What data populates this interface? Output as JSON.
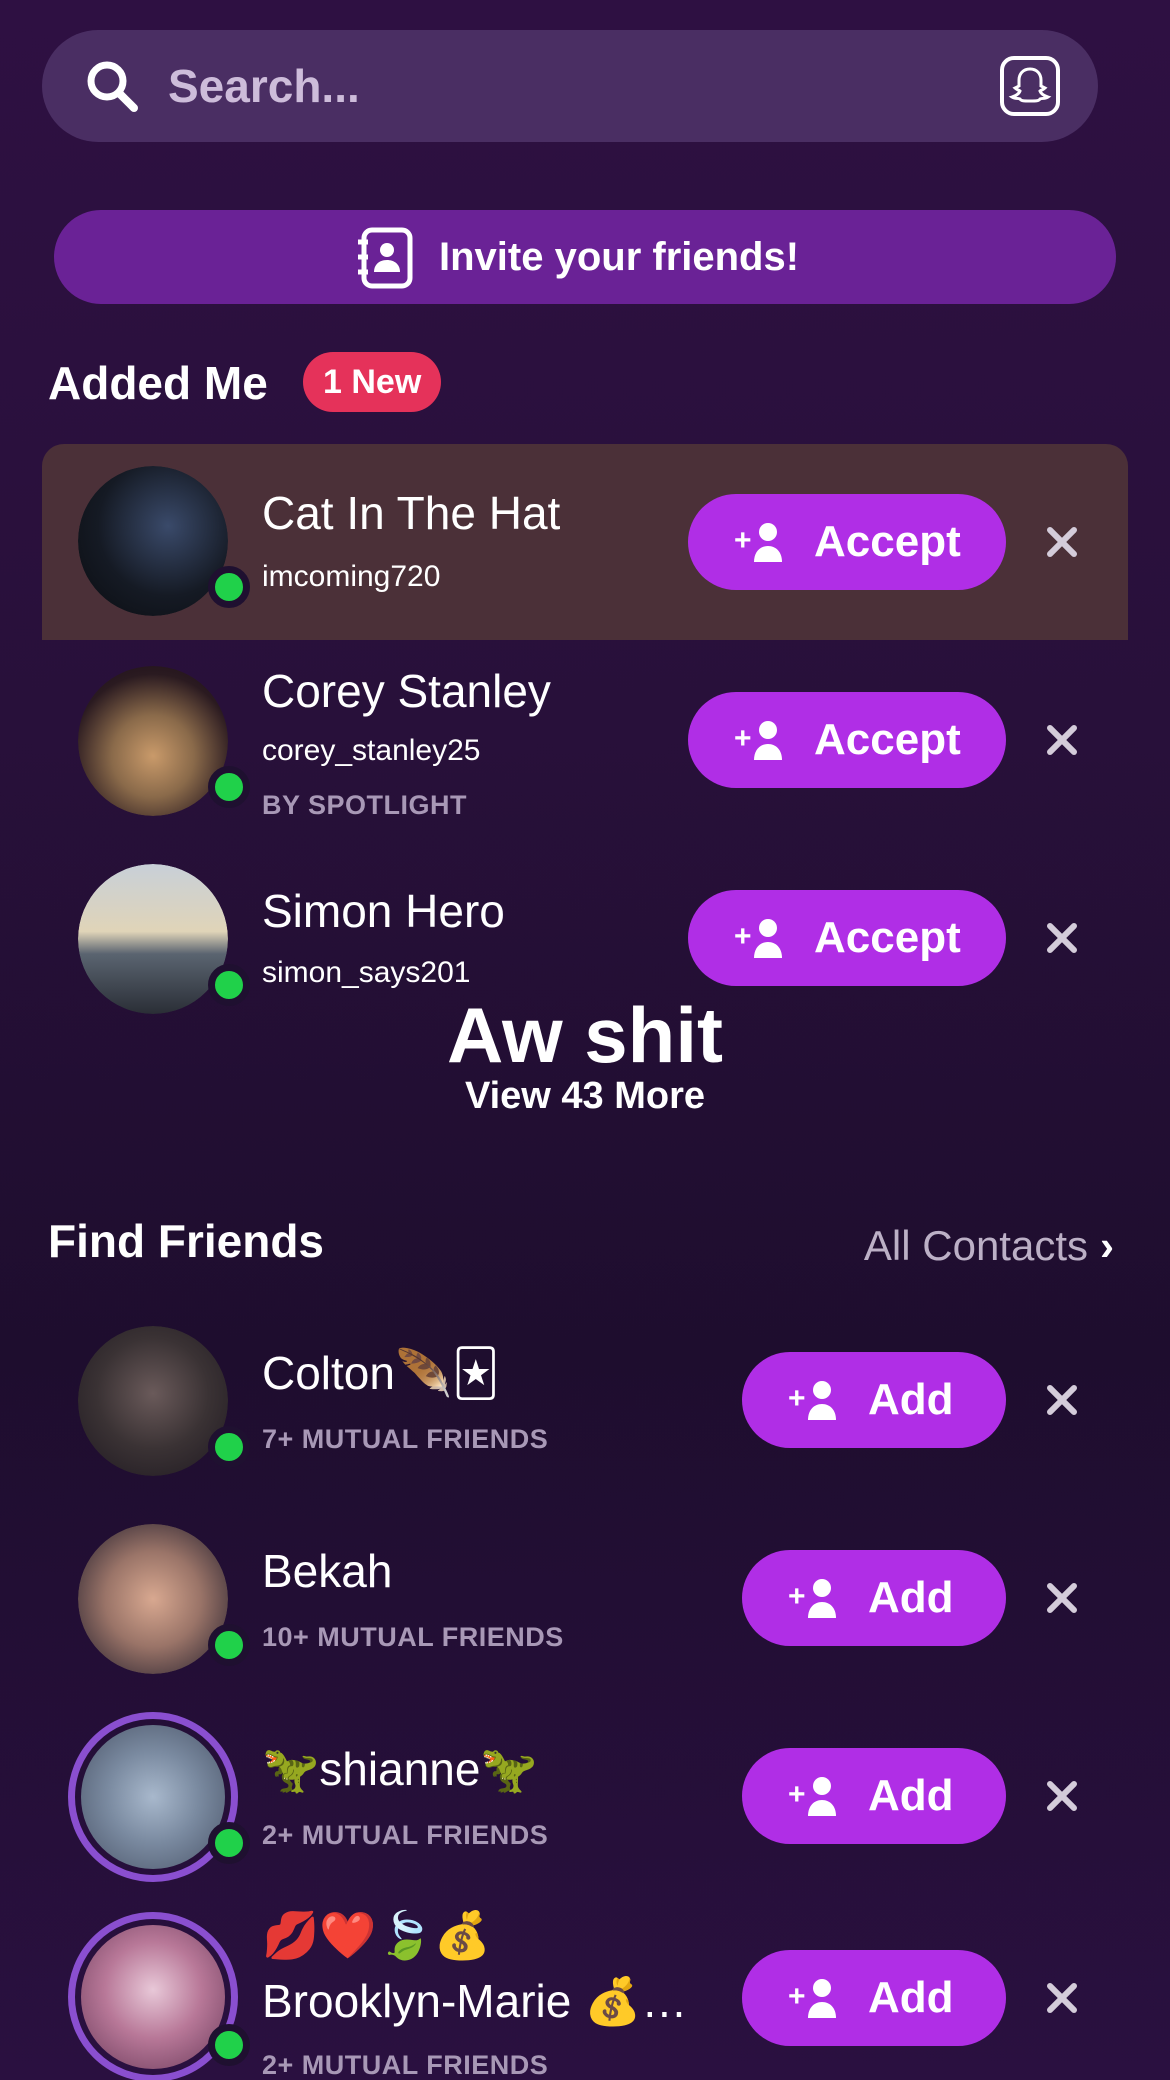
{
  "search": {
    "placeholder": "Search..."
  },
  "invite": {
    "label": "Invite your friends!"
  },
  "added_me": {
    "title": "Added Me",
    "badge": "1 New",
    "rows": [
      {
        "name": "Cat In The Hat",
        "username": "imcoming720",
        "meta": "",
        "button": "Accept"
      },
      {
        "name": "Corey Stanley",
        "username": "corey_stanley25",
        "meta": "BY SPOTLIGHT",
        "button": "Accept"
      },
      {
        "name": "Simon Hero",
        "username": "simon_says201",
        "meta": "",
        "button": "Accept"
      }
    ]
  },
  "overlay_caption": "Aw shit",
  "view_more": "View 43 More",
  "find_friends": {
    "title": "Find Friends",
    "all_contacts": "All Contacts",
    "rows": [
      {
        "name": "Colton🪶🃏",
        "meta": "7+ MUTUAL FRIENDS",
        "button": "Add"
      },
      {
        "name": "Bekah",
        "meta": "10+ MUTUAL FRIENDS",
        "button": "Add"
      },
      {
        "name": "🦖shianne🦖",
        "meta": "2+ MUTUAL FRIENDS",
        "button": "Add"
      },
      {
        "name_line1": "💋❤️🍃💰",
        "name": "Brooklyn-Marie 💰…",
        "meta": "2+ MUTUAL FRIENDS",
        "button": "Add"
      }
    ]
  },
  "colors": {
    "accent_button": "#b02ee6",
    "online": "#20d14a",
    "badge": "#e5325a",
    "highlight_row": "#4b3038"
  }
}
